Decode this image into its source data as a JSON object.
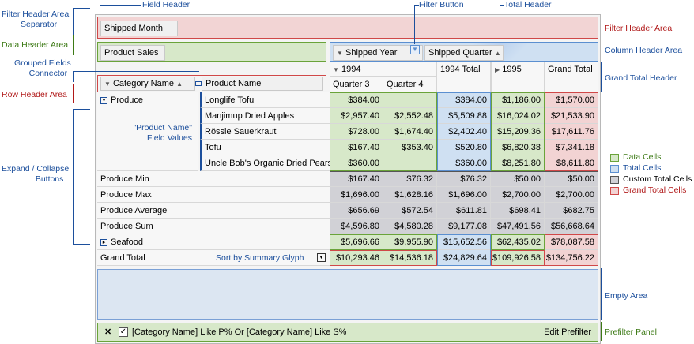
{
  "annotations": {
    "field_header": "Field Header",
    "filter_button": "Filter Button",
    "total_header": "Total Header",
    "filter_header_sep_1": "Filter Header Area",
    "filter_header_sep_2": "Separator",
    "data_header_area": "Data Header Area",
    "grouped_fields_1": "Grouped Fields",
    "grouped_fields_2": "Connector",
    "row_header_area": "Row Header Area",
    "product_name_values_1": "\"Product Name\"",
    "product_name_values_2": "Field Values",
    "expand_collapse_1": "Expand / Collapse",
    "expand_collapse_2": "Buttons",
    "sort_glyph": "Sort by Summary Glyph",
    "filter_header_area": "Filter Header Area",
    "column_header_area": "Column Header Area",
    "grand_total_header": "Grand Total Header",
    "empty_area": "Empty Area",
    "prefilter_panel": "Prefilter Panel"
  },
  "legend": [
    {
      "label": "Data Cells",
      "color": "#d7e8c9",
      "border": "#6aa33a",
      "text_color": "#3d7a16"
    },
    {
      "label": "Total Cells",
      "color": "#cfe0f2",
      "border": "#5b8fd0",
      "text_color": "#1c4f9c"
    },
    {
      "label": "Custom Total Cells",
      "color": "#d1d1d6",
      "border": "#555555",
      "text_color": "#000000"
    },
    {
      "label": "Grand Total Cells",
      "color": "#f2d3d3",
      "border": "#d04848",
      "text_color": "#b01818"
    }
  ],
  "pivot": {
    "filter_field": "Shipped Month",
    "data_field": "Product Sales",
    "column_fields": [
      "Shipped Year",
      "Shipped Quarter"
    ],
    "row_fields": [
      "Category Name",
      "Product Name"
    ],
    "year_1994": "1994",
    "quarter_3": "Quarter 3",
    "quarter_4": "Quarter 4",
    "total_1994": "1994 Total",
    "year_1995": "1995",
    "grand_total_header": "Grand Total",
    "produce_label": "Produce",
    "seafood_label": "Seafood",
    "grand_total_row": "Grand Total",
    "products": [
      {
        "name": "Longlife Tofu",
        "q3": "$384.00",
        "q4": "",
        "t1994": "$384.00",
        "y1995": "$1,186.00",
        "gt": "$1,570.00"
      },
      {
        "name": "Manjimup Dried Apples",
        "q3": "$2,957.40",
        "q4": "$2,552.48",
        "t1994": "$5,509.88",
        "y1995": "$16,024.02",
        "gt": "$21,533.90"
      },
      {
        "name": "Rössle Sauerkraut",
        "q3": "$728.00",
        "q4": "$1,674.40",
        "t1994": "$2,402.40",
        "y1995": "$15,209.36",
        "gt": "$17,611.76"
      },
      {
        "name": "Tofu",
        "q3": "$167.40",
        "q4": "$353.40",
        "t1994": "$520.80",
        "y1995": "$6,820.38",
        "gt": "$7,341.18"
      },
      {
        "name": "Uncle Bob's Organic Dried Pears",
        "q3": "$360.00",
        "q4": "",
        "t1994": "$360.00",
        "y1995": "$8,251.80",
        "gt": "$8,611.80"
      }
    ],
    "custom_totals": [
      {
        "name": "Produce Min",
        "q3": "$167.40",
        "q4": "$76.32",
        "t1994": "$76.32",
        "y1995": "$50.00",
        "gt": "$50.00"
      },
      {
        "name": "Produce Max",
        "q3": "$1,696.00",
        "q4": "$1,628.16",
        "t1994": "$1,696.00",
        "y1995": "$2,700.00",
        "gt": "$2,700.00"
      },
      {
        "name": "Produce Average",
        "q3": "$656.69",
        "q4": "$572.54",
        "t1994": "$611.81",
        "y1995": "$698.41",
        "gt": "$682.75"
      },
      {
        "name": "Produce Sum",
        "q3": "$4,596.80",
        "q4": "$4,580.28",
        "t1994": "$9,177.08",
        "y1995": "$47,491.56",
        "gt": "$56,668.64"
      }
    ],
    "seafood": {
      "q3": "$5,696.66",
      "q4": "$9,955.90",
      "t1994": "$15,652.56",
      "y1995": "$62,435.02",
      "gt": "$78,087.58"
    },
    "grand": {
      "q3": "$10,293.46",
      "q4": "$14,536.18",
      "t1994": "$24,829.64",
      "y1995": "$109,926.58",
      "gt": "$134,756.22"
    },
    "prefilter_text": "[Category Name] Like P% Or [Category Name] Like S%",
    "edit_prefilter": "Edit Prefilter"
  }
}
